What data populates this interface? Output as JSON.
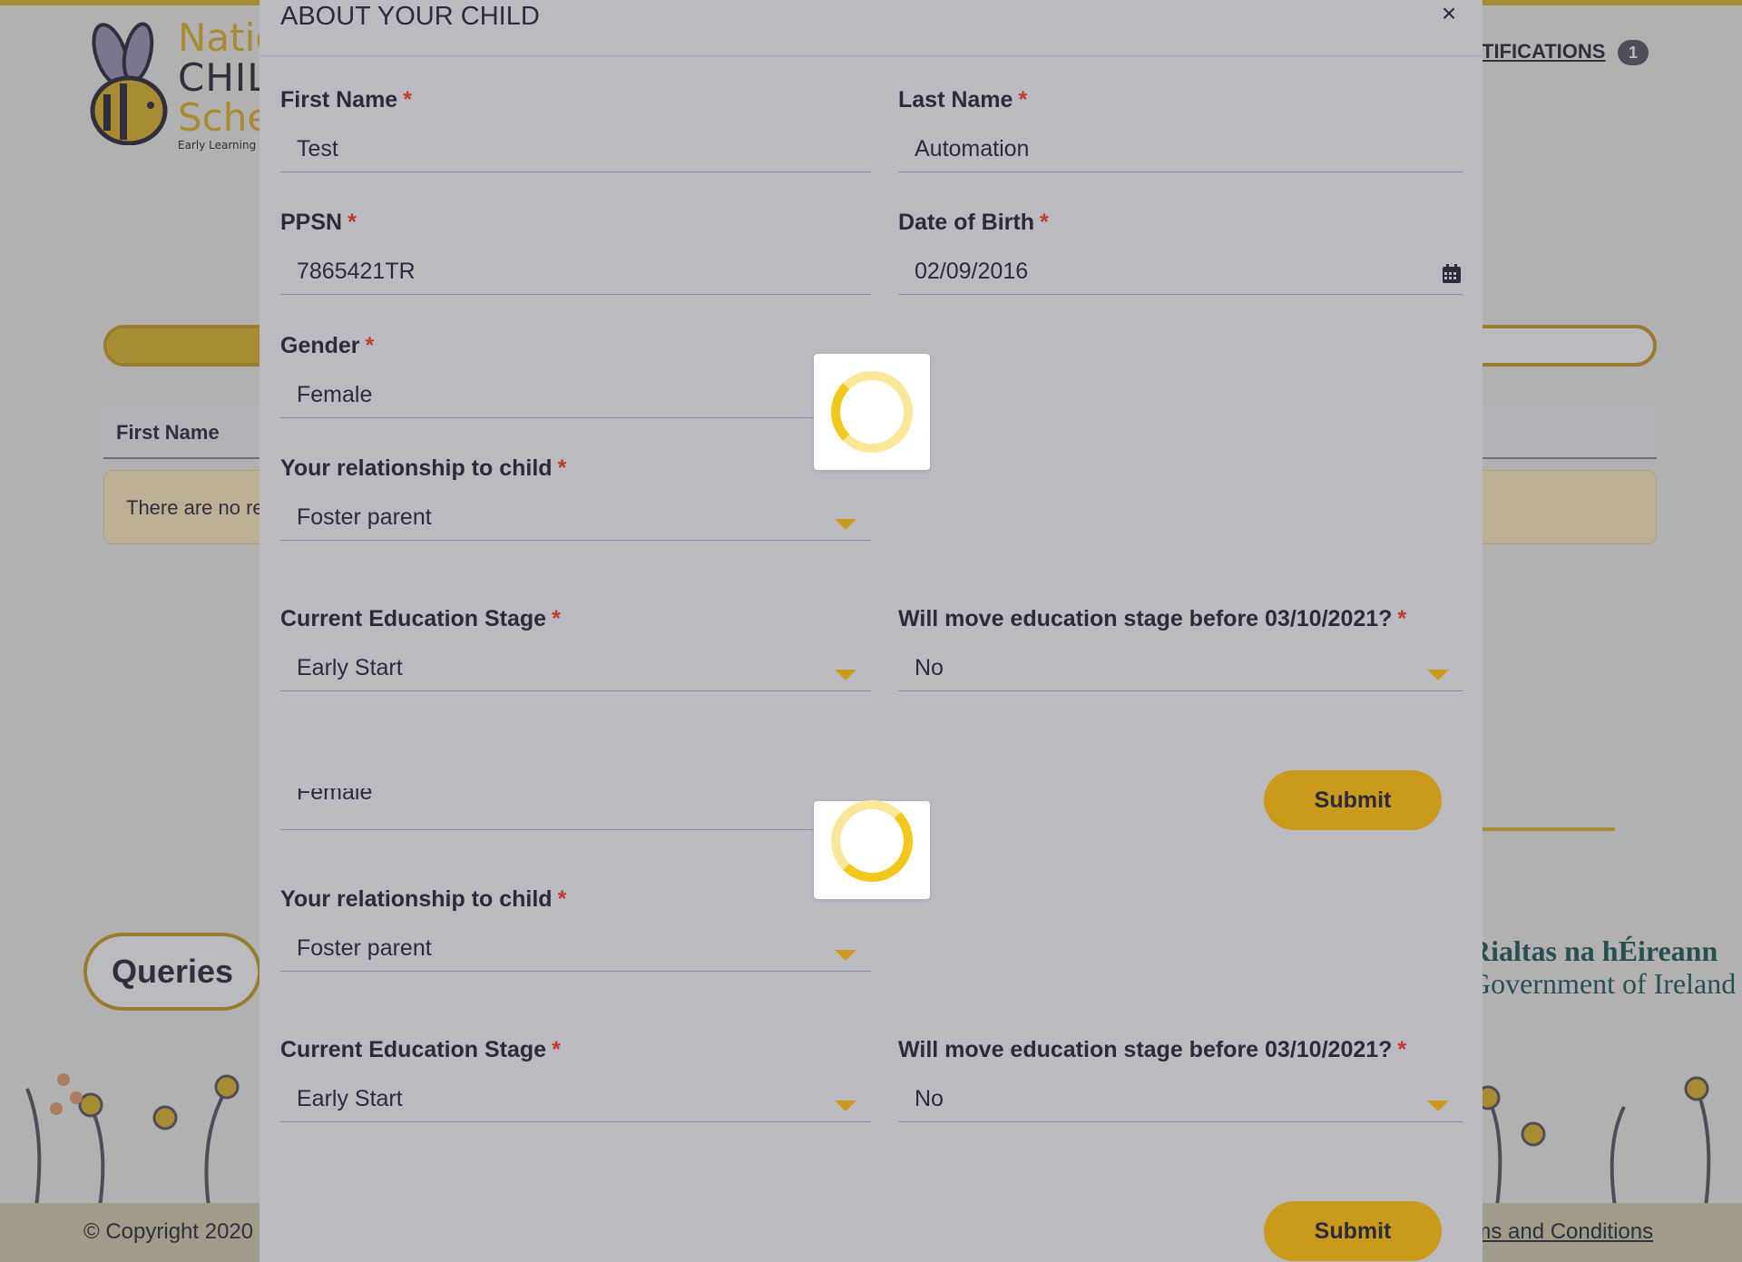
{
  "background": {
    "logo": {
      "line1": "National",
      "line2": "CHILDCARE",
      "line3": "Scheme",
      "line4": "Early Learning & Care"
    },
    "notifications_label": "NOTIFICATIONS",
    "notifications_count": "1",
    "progress_fraction": 0.1,
    "table_header_first": "First Name",
    "empty_message": "There are no records",
    "queries_label": "Queries",
    "government": {
      "line1": "Rialtas na hÉireann",
      "line2": "Government of Ireland"
    },
    "footer": {
      "copyright": "© Copyright 2020",
      "terms": "Terms and Conditions"
    }
  },
  "modal": {
    "title": "ABOUT YOUR CHILD",
    "close_icon": "close-icon",
    "fields": {
      "first_name": {
        "label": "First Name",
        "value": "Test"
      },
      "last_name": {
        "label": "Last Name",
        "value": "Automation"
      },
      "ppsn": {
        "label": "PPSN",
        "value": "7865421TR"
      },
      "dob": {
        "label": "Date of Birth",
        "value": "02/09/2016"
      },
      "gender": {
        "label": "Gender",
        "value": "Female"
      },
      "relationship": {
        "label": "Your relationship to child",
        "value": "Foster parent"
      },
      "education_stage": {
        "label": "Current Education Stage",
        "value": "Early Start"
      },
      "move_stage": {
        "label": "Will move education stage before 03/10/2021?",
        "value": "No"
      }
    },
    "required_marker": "*",
    "submit_label": "Submit",
    "duplicate": {
      "gender_value": "Female",
      "relationship_label": "Your relationship to child",
      "relationship_value": "Foster parent",
      "education_stage_label": "Current Education Stage",
      "education_stage_value": "Early Start",
      "move_stage_label": "Will move education stage before 03/10/2021?",
      "move_stage_value": "No",
      "submit_label": "Submit"
    }
  },
  "colors": {
    "accent": "#c99a1c",
    "required": "#c0392b",
    "text": "#2d2a3a",
    "spinner": "#f2c81e"
  }
}
